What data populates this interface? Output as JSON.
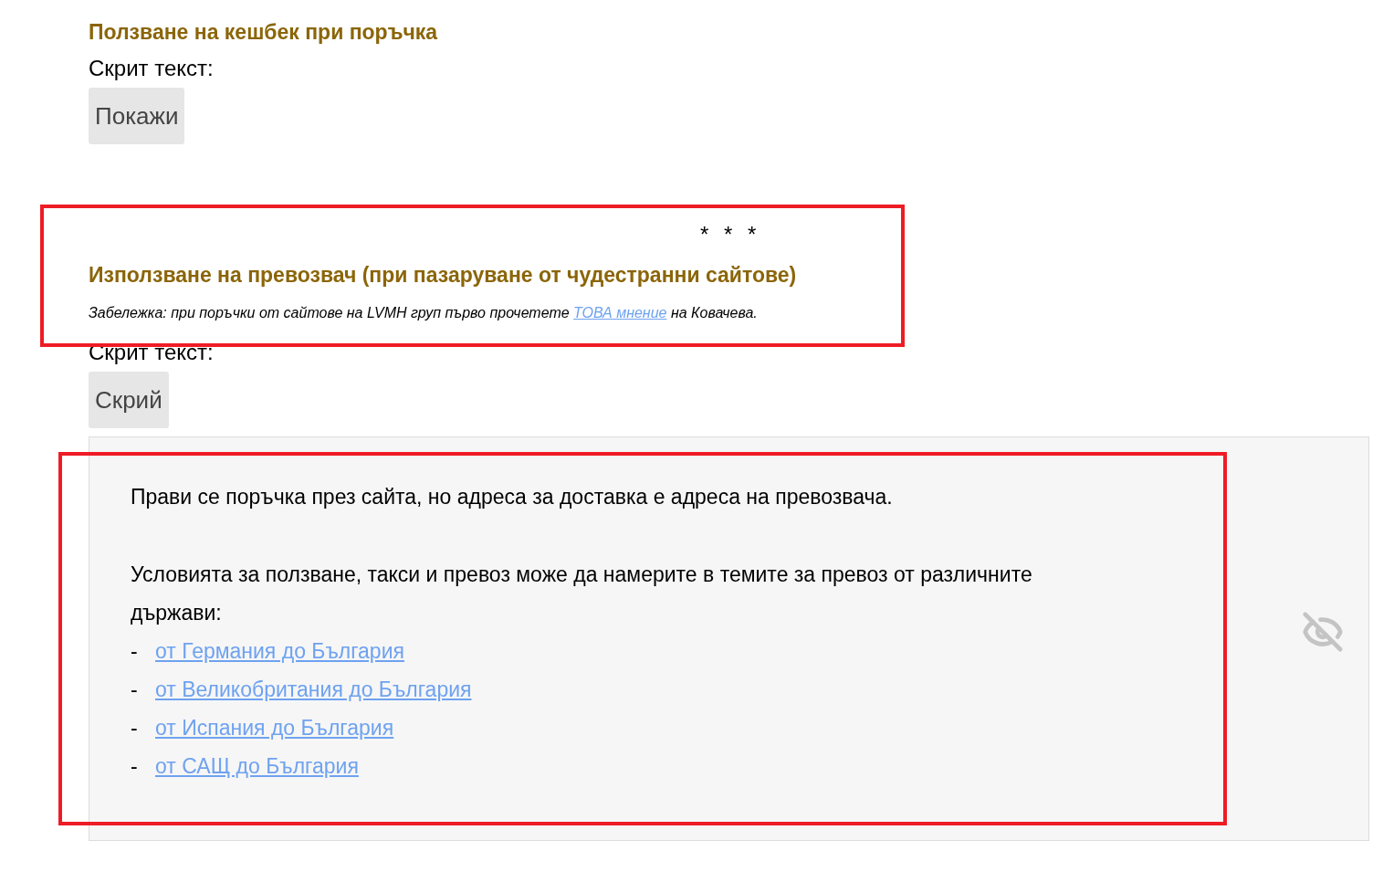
{
  "sections": [
    {
      "heading": "Ползване на кешбек при поръчка",
      "spoiler": {
        "label": "Скрит текст:",
        "button": "Покажи"
      }
    },
    {
      "separator": "* * *",
      "heading": "Използване на превозвач (при пазаруване от чудестранни сайтове)",
      "note": {
        "before": "Забележка: при поръчки от сайтове на LVMH груп първо прочетете ",
        "link": "ТОВА мнение",
        "after": " на Ковачева."
      },
      "spoiler": {
        "label": "Скрит текст:",
        "button": "Скрий",
        "paragraphs": [
          "Прави се поръчка през сайта, но адреса за доставка е адреса на превозвача.",
          "Условията за ползване, такси и превоз може да намерите в темите за превоз от различните държави:"
        ],
        "links": [
          {
            "marker": "-",
            "text": "от Германия до България"
          },
          {
            "marker": "-",
            "text": "от Великобритания до България"
          },
          {
            "marker": "-",
            "text": "от Испания до България"
          },
          {
            "marker": "-",
            "text": "от САЩ до България"
          }
        ]
      }
    }
  ],
  "annotations": [
    {
      "kind": "rectangle"
    },
    {
      "kind": "rectangle"
    }
  ]
}
